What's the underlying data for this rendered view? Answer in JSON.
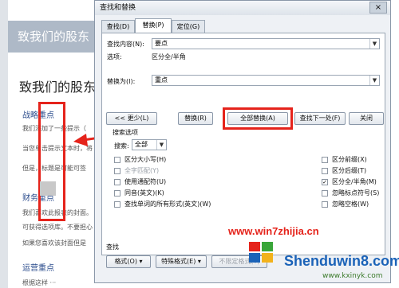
{
  "document": {
    "title": "致我们的股东",
    "heading": "致我们的股东",
    "bullets": [
      "战略重点",
      "财务重点",
      "运营重点"
    ],
    "lines": [
      "我们添加了一些提示（",
      "当您单击提示文本时，将",
      "但是，标题是可能可签",
      "我们喜欢此报表的封面。",
      "可获得选项库。不要担心",
      "如果您喜欢该封面但是"
    ],
    "footer_snippet": "根据这样 ···"
  },
  "dialog": {
    "title": "查找和替换",
    "close_label": "×",
    "tabs": [
      {
        "label": "查找(D)",
        "active": false
      },
      {
        "label": "替换(P)",
        "active": true
      },
      {
        "label": "定位(G)",
        "active": false
      }
    ],
    "find_label": "查找内容(N):",
    "find_value": "要点",
    "options_label": "选项:",
    "options_value": "区分全/半角",
    "replace_label": "替换为(I):",
    "replace_value": "重点",
    "buttons": {
      "less": "<< 更少(L)",
      "replace": "替换(R)",
      "replace_all": "全部替换(A)",
      "find_next": "查找下一处(F)",
      "close": "关闭"
    },
    "search_options_label": "搜索选项",
    "search_label": "搜索:",
    "search_value": "全部",
    "left_options": [
      {
        "label": "区分大小写(H)",
        "checked": false,
        "disabled": false
      },
      {
        "label": "全字匹配(Y)",
        "checked": false,
        "disabled": true
      },
      {
        "label": "使用通配符(U)",
        "checked": false,
        "disabled": false
      },
      {
        "label": "同音(英文)(K)",
        "checked": false,
        "disabled": false
      },
      {
        "label": "查找单词的所有形式(英文)(W)",
        "checked": false,
        "disabled": false
      }
    ],
    "right_options": [
      {
        "label": "区分前缀(X)",
        "checked": false,
        "disabled": false
      },
      {
        "label": "区分后缀(T)",
        "checked": false,
        "disabled": false
      },
      {
        "label": "区分全/半角(M)",
        "checked": true,
        "disabled": false
      },
      {
        "label": "忽略标点符号(S)",
        "checked": false,
        "disabled": false
      },
      {
        "label": "忽略空格(W)",
        "checked": false,
        "disabled": false
      }
    ],
    "find_section_label": "查找",
    "bottom_buttons": {
      "format": "格式(O) ▾",
      "special": "特殊格式(E) ▾",
      "no_format": "不限定格式(T)"
    }
  },
  "watermark": {
    "line1": "www.win7zhijia.cn",
    "line2": "Shenduwin8.com",
    "line3": "www.kxinyk.com"
  },
  "colors": {
    "annotation_red": "#e5231b",
    "dialog_bg": "#eef1f5",
    "doc_banner": "#aeb9c7"
  }
}
